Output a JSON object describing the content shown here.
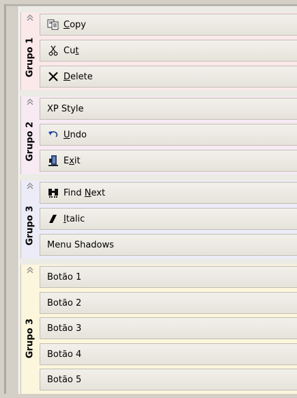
{
  "groups": [
    {
      "label": "Grupo 1",
      "items": [
        {
          "pre": "",
          "accel": "C",
          "post": "opy",
          "icon": "copy-icon"
        },
        {
          "pre": "Cu",
          "accel": "t",
          "post": "",
          "icon": "scissors-icon"
        },
        {
          "pre": "",
          "accel": "D",
          "post": "elete",
          "icon": "delete-x-icon"
        }
      ]
    },
    {
      "label": "Grupo 2",
      "items": [
        {
          "pre": "XP Style",
          "accel": "",
          "post": "",
          "icon": ""
        },
        {
          "pre": "",
          "accel": "U",
          "post": "ndo",
          "icon": "undo-arrow-icon"
        },
        {
          "pre": "E",
          "accel": "x",
          "post": "it",
          "icon": "exit-door-icon"
        }
      ]
    },
    {
      "label": "Grupo 3",
      "items": [
        {
          "pre": "Find ",
          "accel": "N",
          "post": "ext",
          "icon": "binoculars-icon"
        },
        {
          "pre": "",
          "accel": "I",
          "post": "talic",
          "icon": "italic-icon"
        },
        {
          "pre": "Menu Shadows",
          "accel": "",
          "post": "",
          "icon": ""
        }
      ]
    },
    {
      "label": "Grupo 3",
      "items": [
        {
          "pre": "Botão 1",
          "accel": "",
          "post": "",
          "icon": ""
        },
        {
          "pre": "Botão 2",
          "accel": "",
          "post": "",
          "icon": ""
        },
        {
          "pre": "Botão 3",
          "accel": "",
          "post": "",
          "icon": ""
        },
        {
          "pre": "Botão 4",
          "accel": "",
          "post": "",
          "icon": ""
        },
        {
          "pre": "Botão 5",
          "accel": "",
          "post": "",
          "icon": ""
        }
      ]
    }
  ],
  "colors": {
    "group1_bg": "#fbe9ea",
    "group2_bg": "#f7eaf3",
    "group3_bg": "#ecebf8",
    "group4_bg": "#fbf6dc",
    "button_border": "#c1bdb3"
  }
}
